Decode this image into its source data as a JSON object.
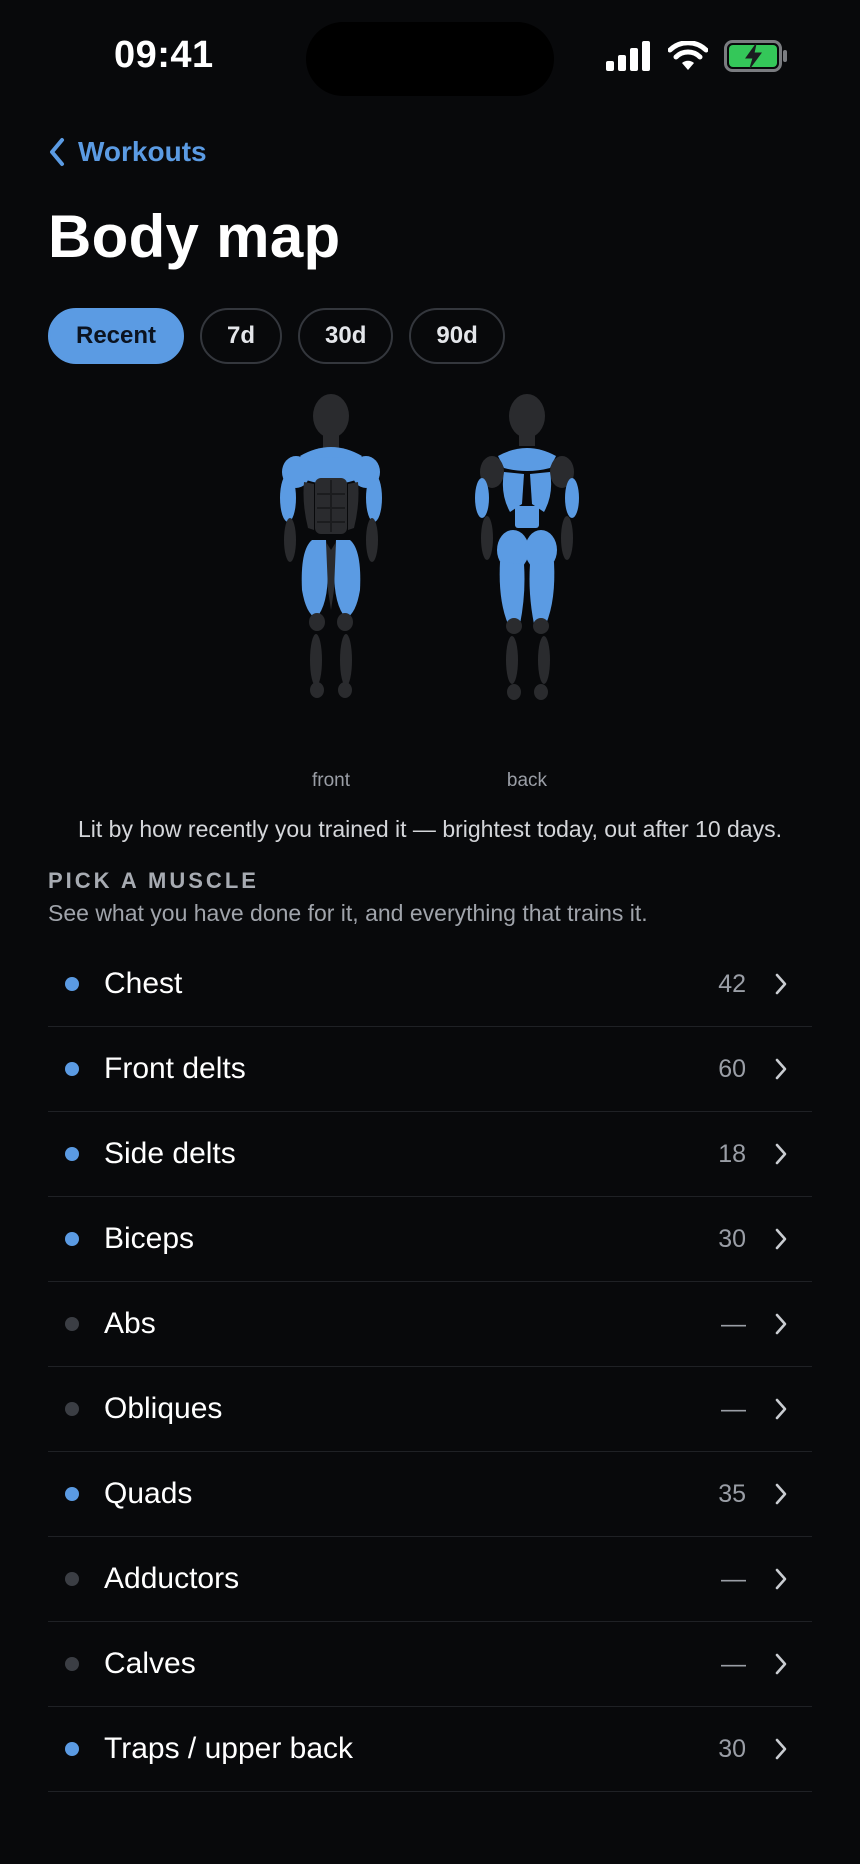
{
  "status_bar": {
    "time": "09:41",
    "icons": [
      "signal-icon",
      "wifi-icon",
      "battery-charging-icon"
    ]
  },
  "nav": {
    "back_label": "Workouts",
    "back_icon": "chevron-left-icon"
  },
  "title": "Body map",
  "range_tabs": [
    {
      "label": "Recent",
      "active": true
    },
    {
      "label": "7d",
      "active": false
    },
    {
      "label": "30d",
      "active": false
    },
    {
      "label": "90d",
      "active": false
    }
  ],
  "body_map": {
    "front_label": "front",
    "back_label": "back",
    "caption": "Lit by how recently you trained it — brightest today, out after 10 days.",
    "colors": {
      "lit": "#5b9be3",
      "unlit": "#2a2b2e"
    }
  },
  "section": {
    "title": "PICK A MUSCLE",
    "subtitle": "See what you have done for it, and everything that trains it."
  },
  "muscles": [
    {
      "name": "Chest",
      "count": "42",
      "active": true
    },
    {
      "name": "Front delts",
      "count": "60",
      "active": true
    },
    {
      "name": "Side delts",
      "count": "18",
      "active": true
    },
    {
      "name": "Biceps",
      "count": "30",
      "active": true
    },
    {
      "name": "Abs",
      "count": "—",
      "active": false
    },
    {
      "name": "Obliques",
      "count": "—",
      "active": false
    },
    {
      "name": "Quads",
      "count": "35",
      "active": true
    },
    {
      "name": "Adductors",
      "count": "—",
      "active": false
    },
    {
      "name": "Calves",
      "count": "—",
      "active": false
    },
    {
      "name": "Traps / upper back",
      "count": "30",
      "active": true
    }
  ]
}
